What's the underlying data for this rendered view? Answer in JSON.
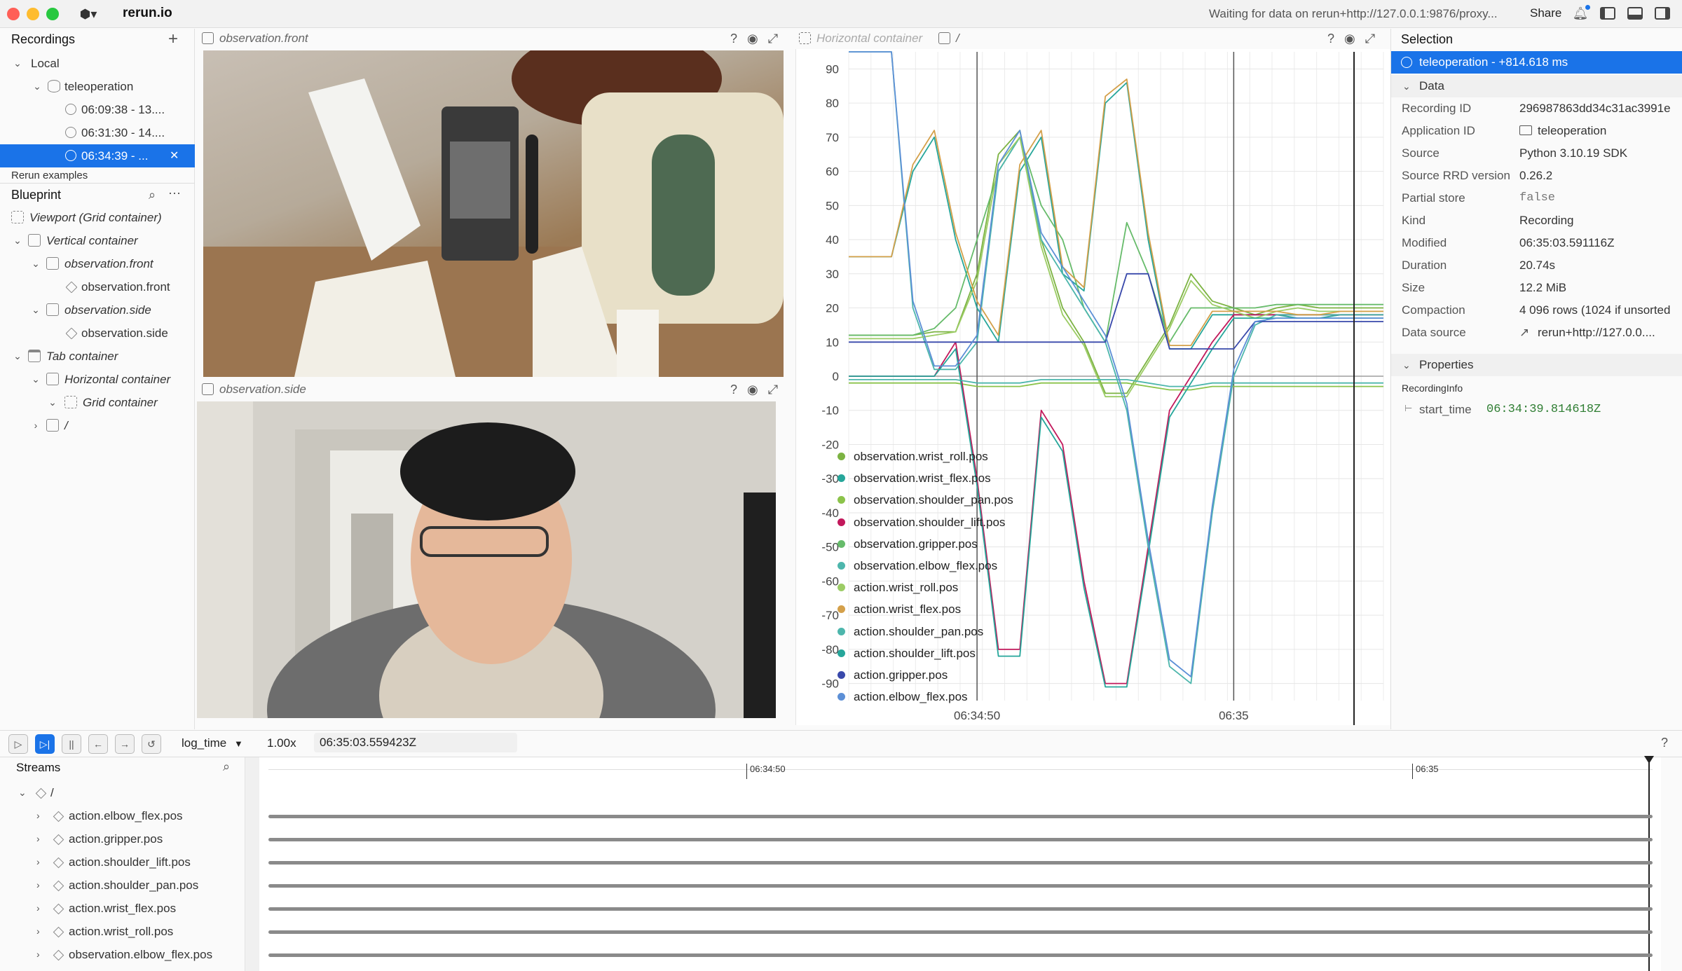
{
  "app": {
    "title": "rerun.io",
    "status": "Waiting for data on rerun+http://127.0.0.1:9876/proxy...",
    "share_label": "Share"
  },
  "recordings": {
    "header": "Recordings",
    "local_label": "Local",
    "app_label": "teleoperation",
    "items": [
      {
        "label": "06:09:38 - 13...."
      },
      {
        "label": "06:31:30 - 14...."
      },
      {
        "label": "06:34:39 - ..."
      }
    ],
    "examples_label": "Rerun examples"
  },
  "blueprint": {
    "header": "Blueprint",
    "rows": [
      {
        "label": "Viewport (Grid container)"
      },
      {
        "label": "Vertical container"
      },
      {
        "label": "observation.front"
      },
      {
        "label": "observation.front"
      },
      {
        "label": "observation.side"
      },
      {
        "label": "observation.side"
      },
      {
        "label": "Tab container"
      },
      {
        "label": "Horizontal container"
      },
      {
        "label": "Grid container"
      },
      {
        "label": "/"
      }
    ]
  },
  "views": {
    "front_title": "observation.front",
    "side_title": "observation.side",
    "horizontal_tab": "Horizontal container",
    "plot_tab": "/"
  },
  "chart_data": {
    "type": "line",
    "ylim": [
      -95,
      95
    ],
    "yticks": [
      90,
      80,
      70,
      60,
      50,
      40,
      30,
      20,
      10,
      0,
      -10,
      -20,
      -30,
      -40,
      -50,
      -60,
      -70,
      -80,
      -90
    ],
    "xticks": [
      "06:34:50",
      "06:35"
    ],
    "x": [
      0,
      0.04,
      0.08,
      0.12,
      0.16,
      0.2,
      0.24,
      0.28,
      0.32,
      0.36,
      0.4,
      0.44,
      0.48,
      0.52,
      0.56,
      0.6,
      0.64,
      0.68,
      0.72,
      0.76,
      0.8,
      0.84,
      0.88,
      0.92,
      0.96,
      1.0
    ],
    "series": [
      {
        "name": "observation.wrist_roll.pos",
        "color": "#7cb342",
        "values": [
          12,
          12,
          12,
          12,
          13,
          13,
          30,
          65,
          72,
          40,
          20,
          10,
          -5,
          -5,
          5,
          15,
          30,
          22,
          20,
          18,
          20,
          21,
          20,
          20,
          20,
          20
        ]
      },
      {
        "name": "observation.wrist_flex.pos",
        "color": "#26a69a",
        "values": [
          35,
          35,
          35,
          60,
          70,
          40,
          20,
          10,
          60,
          70,
          30,
          25,
          80,
          86,
          40,
          8,
          8,
          18,
          18,
          18,
          18,
          17,
          17,
          18,
          18,
          18
        ]
      },
      {
        "name": "observation.shoulder_pan.pos",
        "color": "#8bc34a",
        "values": [
          -2,
          -2,
          -2,
          -2,
          -2,
          -2,
          -3,
          -3,
          -3,
          -2,
          -2,
          -2,
          -2,
          -2,
          -3,
          -4,
          -4,
          -3,
          -3,
          -3,
          -3,
          -3,
          -3,
          -3,
          -3,
          -3
        ]
      },
      {
        "name": "observation.shoulder_lift.pos",
        "color": "#c2185b",
        "values": [
          0,
          0,
          0,
          0,
          0,
          10,
          -30,
          -80,
          -80,
          -10,
          -20,
          -60,
          -90,
          -90,
          -50,
          -10,
          0,
          10,
          18,
          18,
          18,
          18,
          18,
          18,
          18,
          18
        ]
      },
      {
        "name": "observation.gripper.pos",
        "color": "#66bb6a",
        "values": [
          12,
          12,
          12,
          12,
          14,
          20,
          40,
          60,
          70,
          50,
          40,
          20,
          10,
          45,
          30,
          10,
          20,
          20,
          20,
          20,
          21,
          21,
          21,
          21,
          21,
          21
        ]
      },
      {
        "name": "observation.elbow_flex.pos",
        "color": "#4db6ac",
        "values": [
          95,
          95,
          95,
          20,
          2,
          2,
          10,
          60,
          70,
          40,
          30,
          20,
          10,
          -10,
          -50,
          -85,
          -90,
          -40,
          0,
          15,
          18,
          18,
          18,
          18,
          18,
          18
        ]
      },
      {
        "name": "action.wrist_roll.pos",
        "color": "#9ccc65",
        "values": [
          11,
          11,
          11,
          11,
          12,
          13,
          28,
          62,
          70,
          38,
          18,
          9,
          -6,
          -6,
          4,
          14,
          28,
          21,
          19,
          17,
          19,
          20,
          19,
          19,
          19,
          19
        ]
      },
      {
        "name": "action.wrist_flex.pos",
        "color": "#d4a04a",
        "values": [
          35,
          35,
          35,
          62,
          72,
          42,
          22,
          12,
          62,
          72,
          32,
          26,
          82,
          87,
          42,
          9,
          9,
          19,
          19,
          19,
          19,
          18,
          18,
          19,
          19,
          19
        ]
      },
      {
        "name": "action.shoulder_pan.pos",
        "color": "#4db6ac",
        "values": [
          -1,
          -1,
          -1,
          -1,
          -1,
          -1,
          -2,
          -2,
          -2,
          -1,
          -1,
          -1,
          -1,
          -1,
          -2,
          -3,
          -3,
          -2,
          -2,
          -2,
          -2,
          -2,
          -2,
          -2,
          -2,
          -2
        ]
      },
      {
        "name": "action.shoulder_lift.pos",
        "color": "#26a69a",
        "values": [
          0,
          0,
          0,
          0,
          0,
          8,
          -32,
          -82,
          -82,
          -12,
          -22,
          -62,
          -91,
          -91,
          -52,
          -12,
          -2,
          8,
          17,
          17,
          17,
          17,
          17,
          17,
          17,
          17
        ]
      },
      {
        "name": "action.gripper.pos",
        "color": "#3949ab",
        "values": [
          10,
          10,
          10,
          10,
          10,
          10,
          10,
          10,
          10,
          10,
          10,
          10,
          10,
          30,
          30,
          8,
          8,
          8,
          8,
          16,
          16,
          16,
          16,
          16,
          16,
          16
        ]
      },
      {
        "name": "action.elbow_flex.pos",
        "color": "#5c8fd6",
        "values": [
          95,
          95,
          95,
          22,
          3,
          3,
          12,
          62,
          72,
          42,
          32,
          22,
          12,
          -8,
          -48,
          -83,
          -88,
          -38,
          2,
          16,
          17,
          17,
          17,
          17,
          17,
          17
        ]
      }
    ]
  },
  "selection": {
    "header": "Selection",
    "selected": "teleoperation - +814.618 ms",
    "data_header": "Data",
    "fields": [
      {
        "key": "Recording ID",
        "value": "296987863dd34c31ac3991e"
      },
      {
        "key": "Application ID",
        "value": "teleoperation"
      },
      {
        "key": "Source",
        "value": "Python 3.10.19 SDK"
      },
      {
        "key": "Source RRD version",
        "value": "0.26.2"
      },
      {
        "key": "Partial store",
        "value": "false"
      },
      {
        "key": "Kind",
        "value": "Recording"
      },
      {
        "key": "Modified",
        "value": "06:35:03.591116Z"
      },
      {
        "key": "Duration",
        "value": "20.74s"
      },
      {
        "key": "Size",
        "value": "12.2 MiB"
      },
      {
        "key": "Compaction",
        "value": "4 096 rows (1024 if unsorted"
      },
      {
        "key": "Data source",
        "value": "rerun+http://127.0.0...."
      }
    ],
    "properties_header": "Properties",
    "recording_info_label": "RecordingInfo",
    "start_time_key": "start_time",
    "start_time_value": "06:34:39.814618Z"
  },
  "timeline": {
    "timeline_name": "log_time",
    "speed": "1.00x",
    "current_time": "06:35:03.559423Z",
    "streams_header": "Streams",
    "root_label": "/",
    "tick_labels": [
      "06:34:50",
      "06:35"
    ],
    "streams": [
      {
        "label": "action.elbow_flex.pos"
      },
      {
        "label": "action.gripper.pos"
      },
      {
        "label": "action.shoulder_lift.pos"
      },
      {
        "label": "action.shoulder_pan.pos"
      },
      {
        "label": "action.wrist_flex.pos"
      },
      {
        "label": "action.wrist_roll.pos"
      },
      {
        "label": "observation.elbow_flex.pos"
      }
    ]
  }
}
